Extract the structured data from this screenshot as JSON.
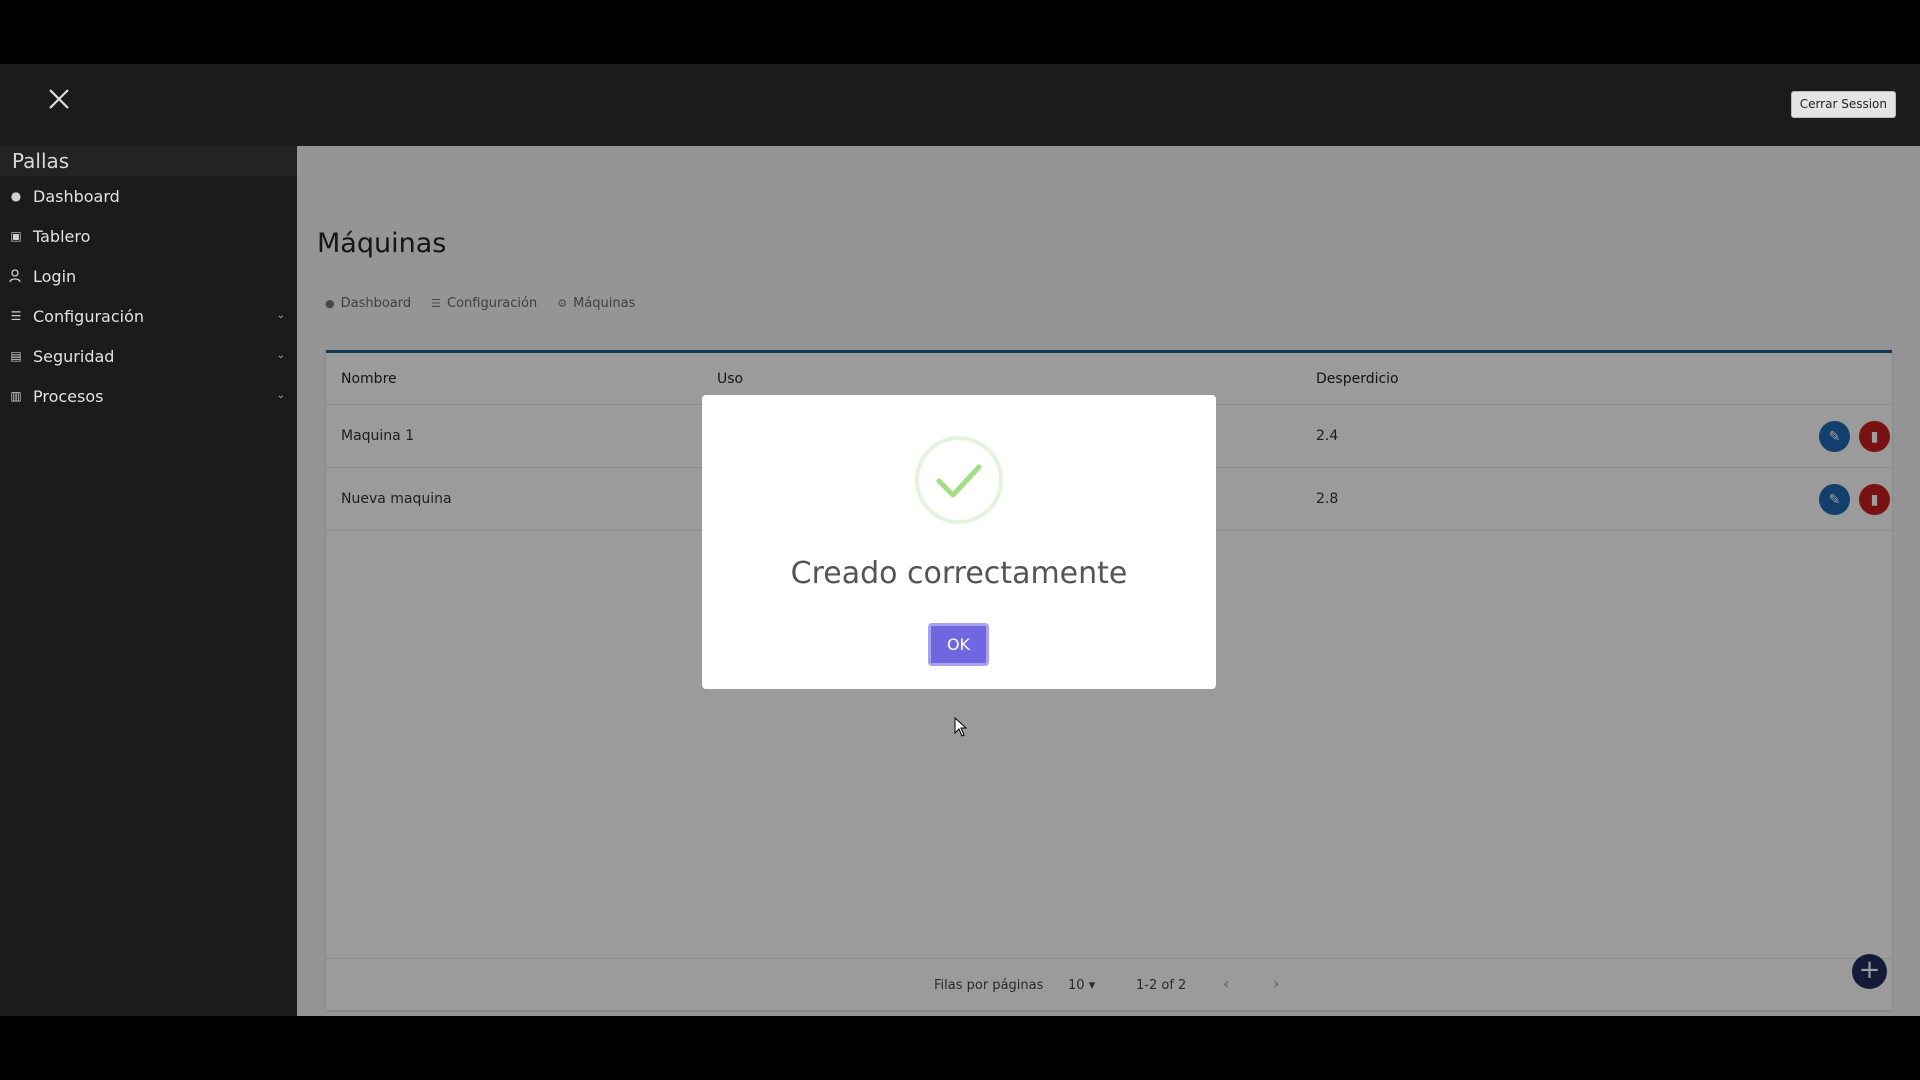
{
  "app": {
    "brand": "Pallas",
    "logout_label": "Cerrar Session"
  },
  "sidebar": {
    "items": [
      {
        "label": "Dashboard",
        "icon": "dashboard-icon"
      },
      {
        "label": "Tablero",
        "icon": "board-icon"
      },
      {
        "label": "Login",
        "icon": "user-icon"
      },
      {
        "label": "Configuración",
        "icon": "list-icon",
        "has_children": true
      },
      {
        "label": "Seguridad",
        "icon": "shield-icon",
        "has_children": true
      },
      {
        "label": "Procesos",
        "icon": "process-icon",
        "has_children": true
      }
    ]
  },
  "page": {
    "title": "Máquinas",
    "breadcrumb": [
      "Dashboard",
      "Configuración",
      "Máquinas"
    ]
  },
  "table": {
    "columns": [
      "Nombre",
      "Uso",
      "Desperdicio"
    ],
    "rows": [
      {
        "nombre": "Maquina 1",
        "desperdicio": "2.4"
      },
      {
        "nombre": "Nueva maquina",
        "desperdicio": "2.8"
      }
    ],
    "pagination": {
      "rows_label": "Filas por páginas",
      "rows_per_page": "10",
      "range": "1-2 of 2"
    }
  },
  "modal": {
    "title": "Creado correctamente",
    "ok_label": "OK"
  },
  "colors": {
    "accent_blue": "#1f66b1",
    "danger": "#c41e1e",
    "ok_button": "#7066e0",
    "success": "#a5dc86"
  }
}
